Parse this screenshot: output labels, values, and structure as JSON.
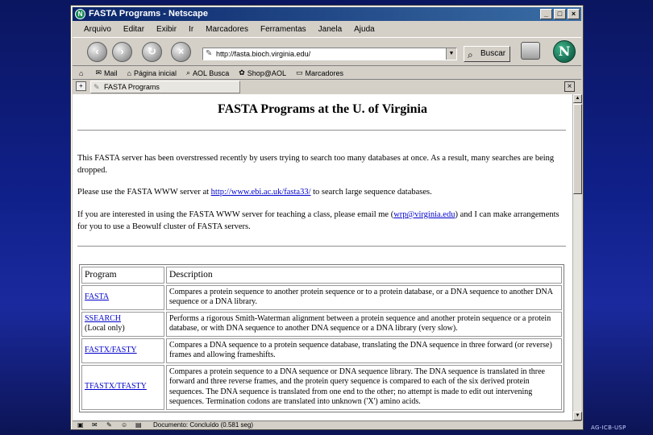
{
  "window": {
    "title": "FASTA Programs - Netscape",
    "app_icon": "netscape-icon",
    "controls": {
      "minimize": "_",
      "maximize": "□",
      "close": "×"
    }
  },
  "menu": [
    "Arquivo",
    "Editar",
    "Exibir",
    "Ir",
    "Marcadores",
    "Ferramentas",
    "Janela",
    "Ajuda"
  ],
  "toolbar": {
    "back_icon": "back-arrow-icon",
    "forward_icon": "forward-arrow-icon",
    "reload_icon": "reload-icon",
    "stop_icon": "stop-icon",
    "url": "http://fasta.bioch.virginia.edu/",
    "search_label": "Buscar"
  },
  "bookmarks": [
    {
      "icon": "home-icon",
      "label": ""
    },
    {
      "icon": "mail-icon",
      "label": "Mail"
    },
    {
      "icon": "home-icon",
      "label": "Página inicial"
    },
    {
      "icon": "search-icon",
      "label": "AOL Busca"
    },
    {
      "icon": "shop-icon",
      "label": "Shop@AOL"
    },
    {
      "icon": "bookmark-icon",
      "label": "Marcadores"
    }
  ],
  "tab": {
    "label": "FASTA Programs"
  },
  "page": {
    "title": "FASTA Programs at the U. of Virginia",
    "notice": "This FASTA server has been overstressed recently by users trying to search too many databases at once. As a result, many searches are being dropped.",
    "ebi_pre": "Please use the FASTA WWW server at",
    "ebi_link": "http://www.ebi.ac.uk/fasta33/",
    "ebi_post": "to search large sequence databases.",
    "teach_pre": "If you are interested in using the FASTA WWW server for teaching a class, please email me (",
    "teach_link": "wrp@virginia.edu",
    "teach_post": ") and I can make arrangements for you to use a Beowulf cluster of FASTA servers."
  },
  "table": {
    "headers": [
      "Program",
      "Description"
    ],
    "rows": [
      {
        "program": "FASTA",
        "note": "",
        "description": "Compares a protein sequence to another protein sequence or to a protein database, or a DNA sequence to another DNA sequence or a DNA library."
      },
      {
        "program": "SSEARCH",
        "note": "(Local only)",
        "description": "Performs a rigorous Smith-Waterman alignment between a protein sequence and another protein sequence or a protein database, or with DNA sequence to another DNA sequence or a DNA library (very slow)."
      },
      {
        "program": "FASTX/FASTY",
        "note": "",
        "description": "Compares a DNA sequence to a protein sequence database, translating the DNA sequence in three forward (or reverse) frames and allowing frameshifts."
      },
      {
        "program": "TFASTX/TFASTY",
        "note": "",
        "description": "Compares a protein sequence to a DNA sequence or DNA sequence library. The DNA sequence is translated in three forward and three reverse frames, and the protein query sequence is compared to each of the six derived protein sequences. The DNA sequence is translated from one end to the other; no attempt is made to edit out intervening sequences. Termination codons are translated into unknown ('X') amino acids."
      }
    ]
  },
  "status": {
    "text": "Documento: Concluído (0.581 seg)"
  },
  "caption": "AG-ICB-USP",
  "colors": {
    "titlebar": "#0a246a",
    "link": "#0000cc",
    "background": "#10208a"
  }
}
